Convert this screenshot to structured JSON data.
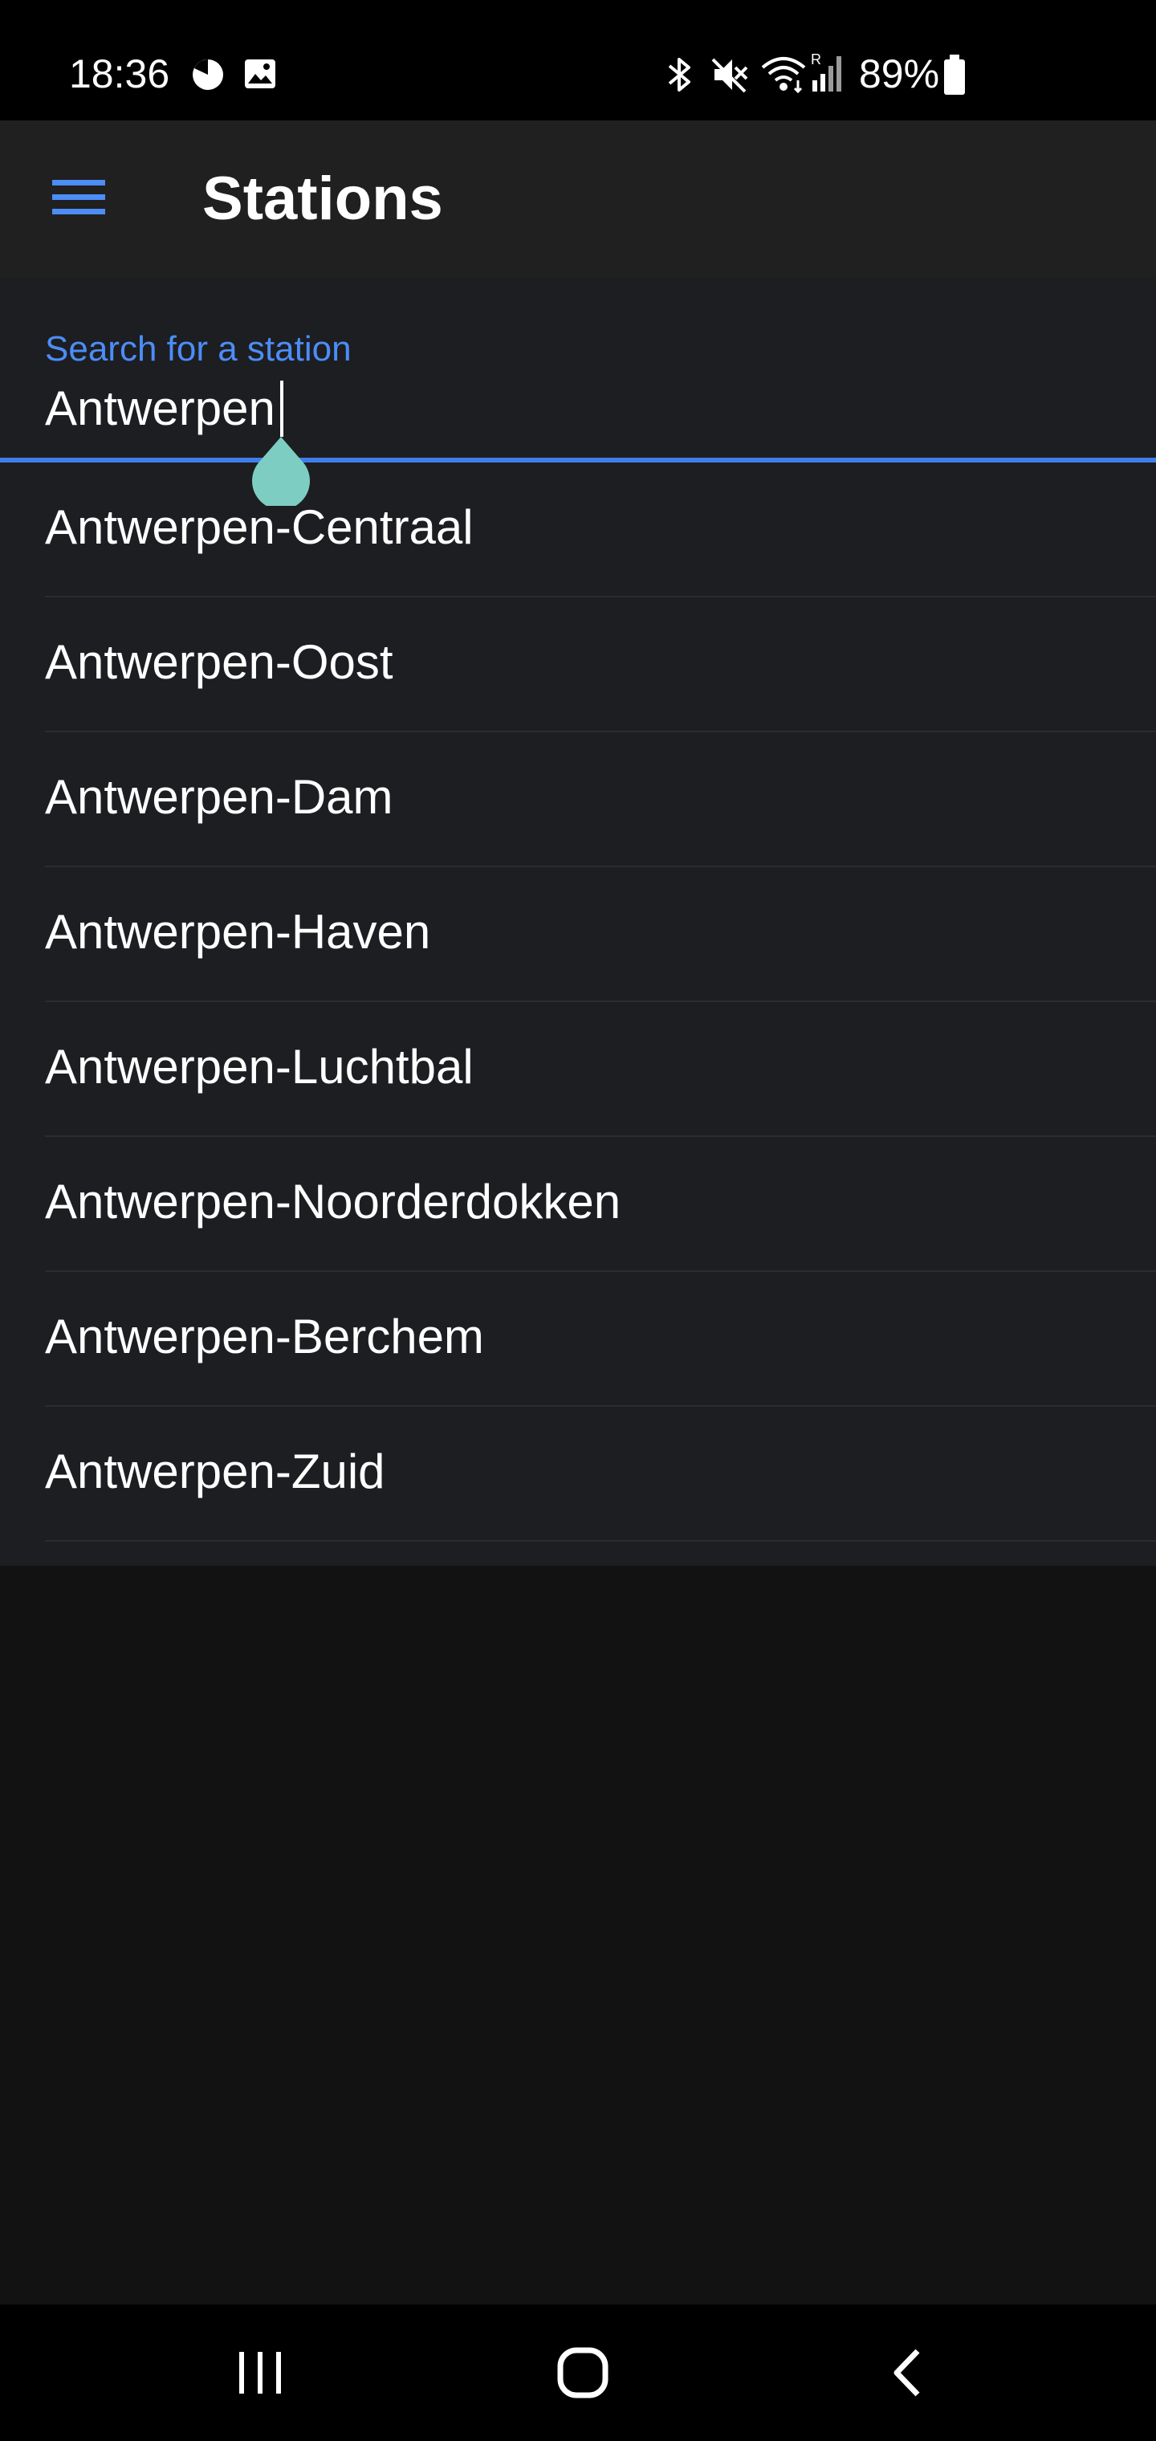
{
  "status_bar": {
    "time": "18:36",
    "battery_percent": "89%",
    "icons": [
      "clock-pie-icon",
      "gallery-icon",
      "bluetooth-icon",
      "mute-icon",
      "wifi-icon",
      "signal-icon",
      "battery-icon"
    ]
  },
  "app_bar": {
    "title": "Stations",
    "menu_icon": "hamburger-menu-icon"
  },
  "search": {
    "label": "Search for a station",
    "value": "Antwerpen"
  },
  "results": [
    {
      "label": "Antwerpen-Centraal"
    },
    {
      "label": "Antwerpen-Oost"
    },
    {
      "label": "Antwerpen-Dam"
    },
    {
      "label": "Antwerpen-Haven"
    },
    {
      "label": "Antwerpen-Luchtbal"
    },
    {
      "label": "Antwerpen-Noorderdokken"
    },
    {
      "label": "Antwerpen-Berchem"
    },
    {
      "label": "Antwerpen-Zuid"
    }
  ],
  "nav_bar": {
    "buttons": [
      "recent-apps-icon",
      "home-icon",
      "back-icon"
    ]
  },
  "colors": {
    "accent": "#4c8df6",
    "underline": "#3f7ee8",
    "caret_handle": "#7ecdc2",
    "app_bar_bg": "#202020",
    "list_bg": "#1d1e22",
    "page_bg": "#121212"
  }
}
